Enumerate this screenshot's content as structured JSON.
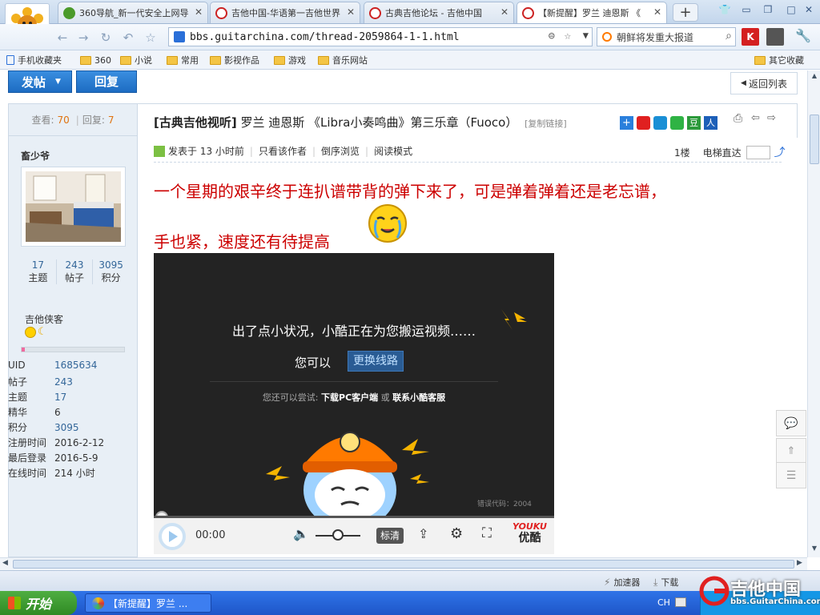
{
  "tabs": [
    {
      "title": "360导航_新一代安全上网导",
      "icon_color": "#4a9a2a",
      "active": false
    },
    {
      "title": "吉他中国-华语第一吉他世界",
      "icon_color": "#cc2222",
      "active": false
    },
    {
      "title": "古典吉他论坛 - 吉他中国",
      "icon_color": "#cc2222",
      "active": false
    },
    {
      "title": "【新提醒】罗兰 迪恩斯 《",
      "icon_color": "#cc2222",
      "active": true
    }
  ],
  "newtab_label": "+",
  "address": {
    "url": "bbs.guitarchina.com/thread-2059864-1-1.html"
  },
  "search": {
    "text": "朝鲜将发重大报道"
  },
  "bookmarks": [
    "手机收藏夹",
    "360",
    "小说",
    "常用",
    "影视作品",
    "游戏",
    "音乐网站"
  ],
  "bookmarks_right": "其它收藏",
  "forum": {
    "post_button": "发帖",
    "reply_button": "回复",
    "back_to_list": "返回列表",
    "view_label": "查看:",
    "view_count": "70",
    "reply_label": "回复:",
    "reply_count": "7"
  },
  "user": {
    "name": "畜少爷",
    "stats": [
      {
        "value": "17",
        "label": "主题"
      },
      {
        "value": "243",
        "label": "帖子"
      },
      {
        "value": "3095",
        "label": "积分"
      }
    ],
    "rank": "吉他侠客",
    "profile": [
      {
        "key": "UID",
        "value": "1685634",
        "link": true
      },
      {
        "key": "帖子",
        "value": "243",
        "link": true
      },
      {
        "key": "主题",
        "value": "17",
        "link": true
      },
      {
        "key": "精华",
        "value": "6",
        "link": false
      },
      {
        "key": "积分",
        "value": "3095",
        "link": true
      },
      {
        "key": "注册时间",
        "value": "2016-2-12",
        "link": false
      },
      {
        "key": "最后登录",
        "value": "2016-5-9",
        "link": false
      },
      {
        "key": "在线时间",
        "value": "214 小时",
        "link": false
      }
    ]
  },
  "thread": {
    "category": "[古典吉他视听]",
    "title": "罗兰 迪恩斯 《Libra小奏鸣曲》第三乐章（Fuoco）",
    "copy_link": "[复制链接]",
    "posted": "发表于 13 小时前",
    "only_author": "只看该作者",
    "reverse": "倒序浏览",
    "read_mode": "阅读模式",
    "floor": "1楼",
    "elevator": "电梯直达"
  },
  "post_text": {
    "line1": "一个星期的艰辛终于连扒谱带背的弹下来了，可是弹着弹着还是老忘谱，",
    "line2": "手也紧，速度还有待提高"
  },
  "video": {
    "error_msg": "出了点小状况，小酷正在为您搬运视频……",
    "you_can": "您可以",
    "switch_line": "更换线路",
    "alt_prefix": "您还可以尝试:",
    "download_pc": "下载PC客户端",
    "or": "或",
    "contact": "联系小酷客服",
    "error_code": "错误代码：2004",
    "mascot_hat": "YOUKU",
    "time": "00:00",
    "quality": "标清",
    "brand_top": "YOUKU",
    "brand_bottom": "优酷"
  },
  "status": {
    "accelerator": "加速器",
    "download": "下载"
  },
  "taskbar": {
    "start": "开始",
    "task": "【新提醒】罗兰 ...",
    "lang": "CH"
  },
  "watermark": {
    "title": "吉他中国",
    "url": "bbs.GuitarChina.com"
  }
}
